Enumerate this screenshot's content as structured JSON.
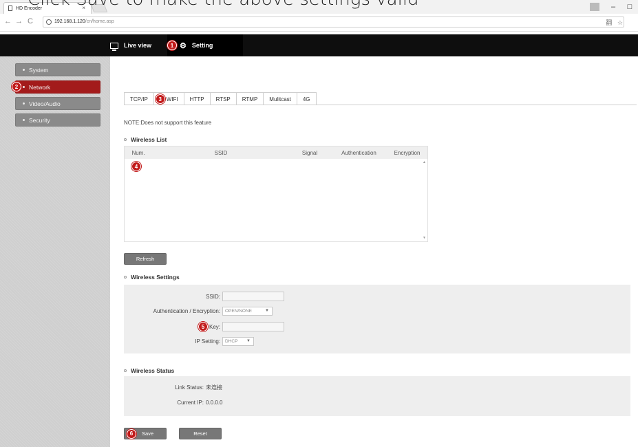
{
  "caption": "Click Save to make the above settings valid",
  "browser": {
    "tab_title": "HD Encoder",
    "tab_close": "×",
    "url_host": "192.168.1.120",
    "url_path": "/cn/home.asp",
    "back": "←",
    "forward": "→",
    "reload": "C",
    "win_minimize": "–",
    "win_maximize": "□",
    "translate_icon": "翻",
    "star_icon": "☆"
  },
  "header": {
    "live_view": "Live view",
    "setting": "Setting",
    "marker_setting": "1"
  },
  "sidebar": {
    "items": [
      {
        "label": "System",
        "active": false
      },
      {
        "label": "Network",
        "active": true
      },
      {
        "label": "Video/Audio",
        "active": false
      },
      {
        "label": "Security",
        "active": false
      }
    ],
    "marker_network": "2"
  },
  "tabs": [
    "TCP/IP",
    "WIFI",
    "HTTP",
    "RTSP",
    "RTMP",
    "Mulitcast",
    "4G"
  ],
  "marker_wifi": "3",
  "note": "NOTE:Does not support this feature",
  "wireless_list": {
    "title": "Wireless List",
    "columns": [
      "Num.",
      "SSID",
      "Signal",
      "Authentication",
      "Encryption"
    ],
    "rows": [],
    "marker": "4"
  },
  "refresh_label": "Refresh",
  "wireless_settings": {
    "title": "Wireless Settings",
    "ssid_label": "SSID:",
    "ssid_value": "",
    "auth_label": "Authentication / Encryption:",
    "auth_value": "OPEN/NONE",
    "key_label": "Key:",
    "key_value": "",
    "key_marker": "5",
    "ip_label": "IP Setting:",
    "ip_value": "DHCP"
  },
  "wireless_status": {
    "title": "Wireless Status",
    "link_label": "Link Status:",
    "link_value": "未连接",
    "ip_label": "Current IP:",
    "ip_value": "0.0.0.0"
  },
  "save_label": "Save",
  "save_marker": "6",
  "reset_label": "Reset",
  "colors": {
    "accent_red": "#a31b1b",
    "header_bg": "#0e0e0e",
    "sidebar_item": "#8a8a8a"
  }
}
